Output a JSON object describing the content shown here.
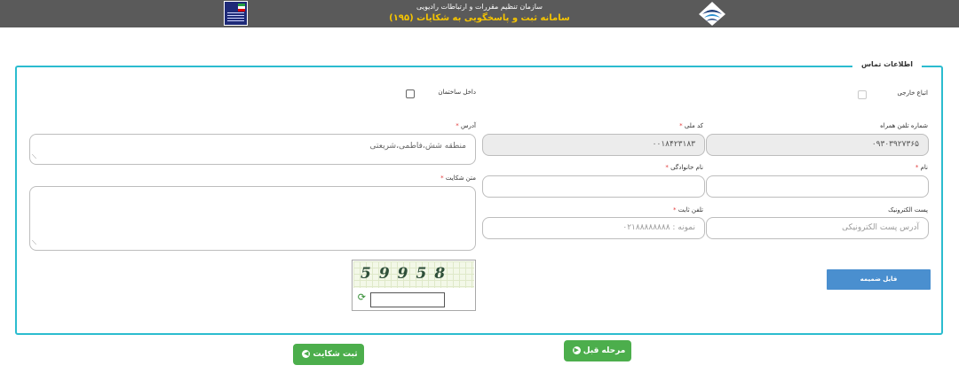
{
  "header": {
    "org_name": "سازمان تنظیم مقررات و ارتباطات رادیویی",
    "system_name": "سامانه ثبت و پاسخگویی به شکایات (۱۹۵)",
    "colors": {
      "background": "#5a5a5a",
      "title": "#ffffff",
      "subtitle": "#f5c400"
    }
  },
  "form": {
    "legend": "اطلاعات تماس",
    "foreign_national_label": "اتباع خارجی",
    "inside_building_label": "داخل ساختمان",
    "mobile_label": "شماره تلفن همراه",
    "mobile_value": "۰۹۳۰۳۹۲۷۳۶۵",
    "national_code_label": "کد ملی",
    "national_code_value": "۰۰۱۸۴۲۳۱۸۳",
    "first_name_label": "نام",
    "first_name_value": "",
    "last_name_label": "نام خانوادگی",
    "last_name_value": "",
    "email_label": "پست الکترونیک",
    "email_placeholder": "آدرس پست الکترونیکی",
    "phone_label": "تلفن ثابت",
    "phone_placeholder": "نمونه : ۰۲۱۸۸۸۸۸۸۸۸",
    "address_label": "آدرس",
    "address_value": "منطقه شش،فاطمی،شریعتی",
    "complaint_label": "متن شکایت",
    "complaint_value": "",
    "required_mark": "*",
    "attach_button": "فایل ضمیمه",
    "captcha_text": "59958",
    "captcha_input_value": "",
    "accent_color": "#2bbccf"
  },
  "actions": {
    "submit_label": "ثبت شکایت",
    "prev_label": "مرحله قبل",
    "button_color": "#4cae4c"
  }
}
